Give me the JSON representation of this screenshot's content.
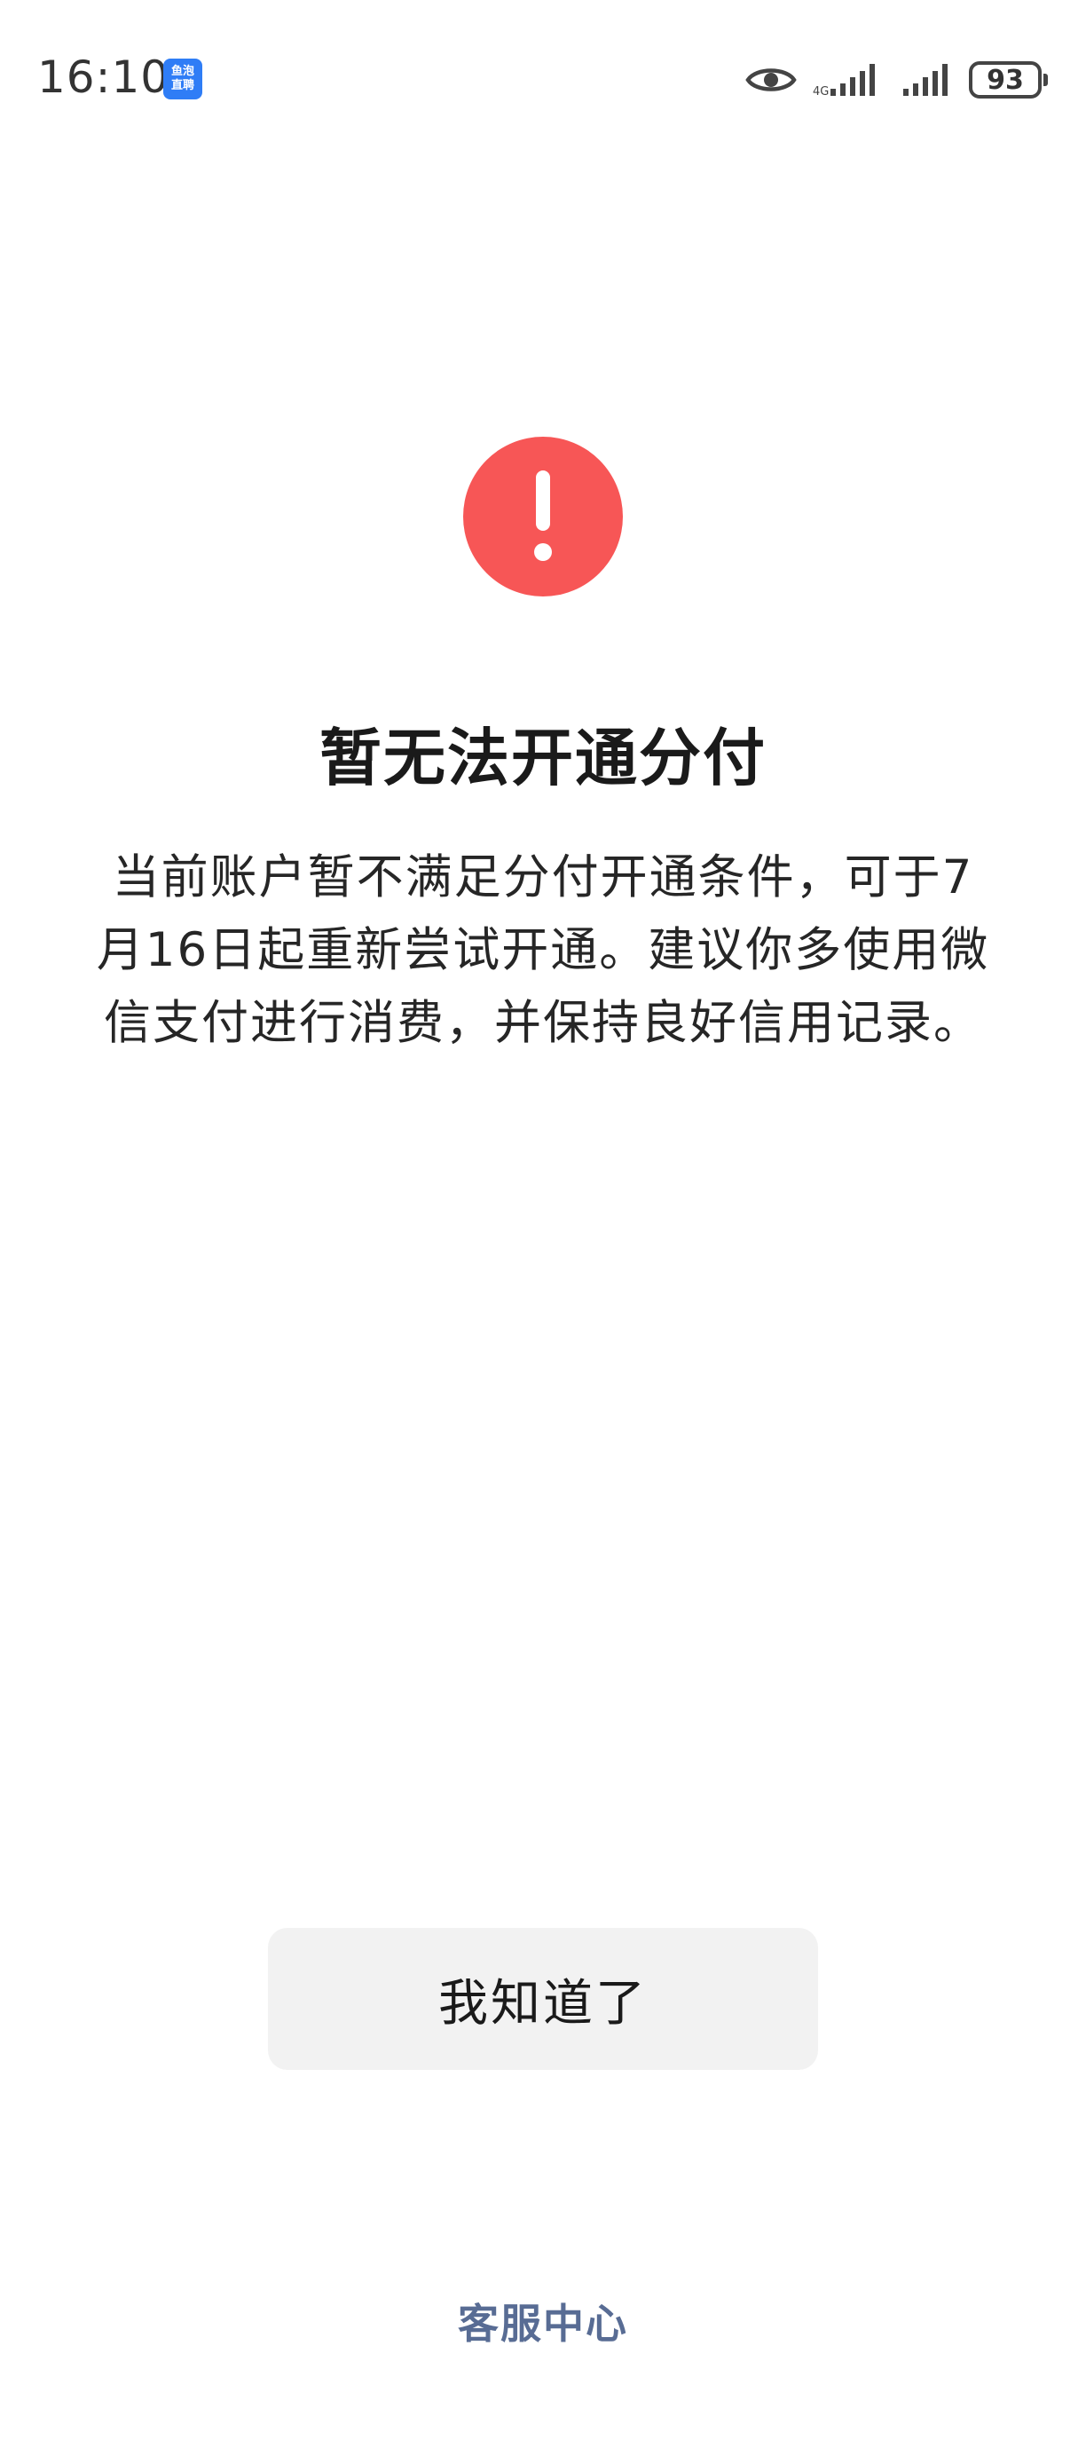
{
  "status_bar": {
    "time": "16:10",
    "app_badge_line1": "鱼泡",
    "app_badge_line2": "直聘",
    "battery": "93",
    "icons": [
      "eye-icon",
      "signal-icon",
      "signal-icon",
      "battery-icon"
    ]
  },
  "dialog": {
    "icon": "exclamation-circle-icon",
    "icon_color": "#f75656",
    "title": "暂无法开通分付",
    "description": "当前账户暂不满足分付开通条件，可于7月16日起重新尝试开通。建议你多使用微信支付进行消费，并保持良好信用记录。"
  },
  "actions": {
    "confirm_label": "我知道了",
    "service_label": "客服中心",
    "service_color": "#586c94"
  }
}
